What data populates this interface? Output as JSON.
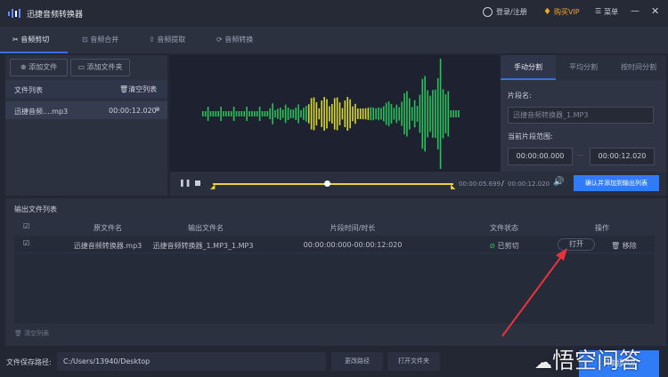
{
  "app": {
    "title": "迅捷音频转换器",
    "login": "登录/注册",
    "vip": "购买VIP",
    "menu": "菜单"
  },
  "tabs": [
    "音频剪切",
    "音频合并",
    "音频提取",
    "音频转换"
  ],
  "left": {
    "add_file": "添加文件",
    "add_folder": "添加文件夹",
    "list_title": "文件列表",
    "clear_list": "清空列表",
    "file": {
      "name": "迅捷音频....mp3",
      "duration": "00:00:12.020"
    }
  },
  "player": {
    "current": "00:00:05.699",
    "separator": "/",
    "total": "00:00:12.020",
    "progress": 0.474
  },
  "split": {
    "tabs": [
      "手动分割",
      "平均分割",
      "按时间分割"
    ],
    "name_label": "片段名:",
    "name_value": "迅捷音频转换器_1.MP3",
    "range_label": "当前片段范围:",
    "start": "00:00:00.000",
    "dash": "—",
    "end": "00:00:12.020",
    "confirm": "确认并添加到输出列表"
  },
  "output": {
    "title": "输出文件列表",
    "headers": [
      "原文件名",
      "输出文件名",
      "片段时间/时长",
      "文件状态",
      "操作"
    ],
    "rows": [
      {
        "source": "迅捷音频转换器.mp3",
        "output": "迅捷音频转换器_1.MP3_1.MP3",
        "range": "00:00:00:000-00:00:12:020",
        "status": "已剪切",
        "open": "打开",
        "remove": "移除"
      }
    ],
    "clear": "清空列表"
  },
  "bottom": {
    "path_label": "文件保存路径:",
    "path": "C:/Users/13940/Desktop",
    "change": "更改路径",
    "open_folder": "打开文件夹",
    "start": "开始剪切"
  },
  "watermark": "悟空问答",
  "colors": {
    "accent": "#2f7cf6",
    "vip": "#f5a623",
    "wave_green": "#27c25a",
    "wave_yellow": "#d9d92a",
    "arrow": "#e8323c"
  }
}
